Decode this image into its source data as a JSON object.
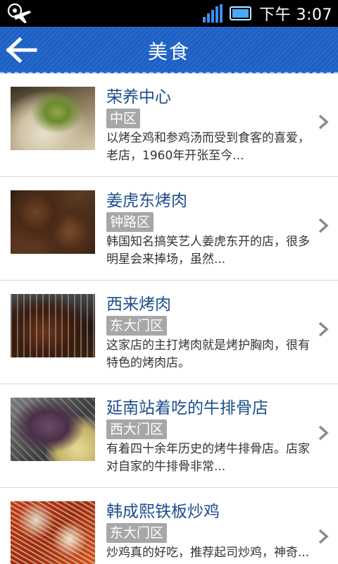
{
  "status_bar": {
    "time": "下午 3:07",
    "icons": [
      "airplane-settings-icon",
      "signal-icon",
      "battery-icon"
    ]
  },
  "header": {
    "title": "美食",
    "back_icon": "back-arrow-icon"
  },
  "colors": {
    "header_bg": "#1b5fc4",
    "name_text": "#1d4e8c",
    "tag_bg": "#a7a7a7"
  },
  "restaurants": [
    {
      "name": "荣养中心",
      "district": "中区",
      "desc": "以烤全鸡和参鸡汤而受到食客的喜爱，老店，1960年开张至今..."
    },
    {
      "name": "姜虎东烤肉",
      "district": "钟路区",
      "desc": "韩国知名搞笑艺人姜虎东开的店，很多明星会来捧场，虽然..."
    },
    {
      "name": "西来烤肉",
      "district": "东大门区",
      "desc": "这家店的主打烤肉就是烤护胸肉，很有特色的烤肉店。"
    },
    {
      "name": "延南站着吃的牛排骨店",
      "district": "西大门区",
      "desc": "有着四十余年历史的烤牛排骨店。店家对自家的牛排骨非常..."
    },
    {
      "name": "韩成熙铁板炒鸡",
      "district": "东大门区",
      "desc": "炒鸡真的好吃，推荐起司炒鸡，神奇..."
    }
  ]
}
